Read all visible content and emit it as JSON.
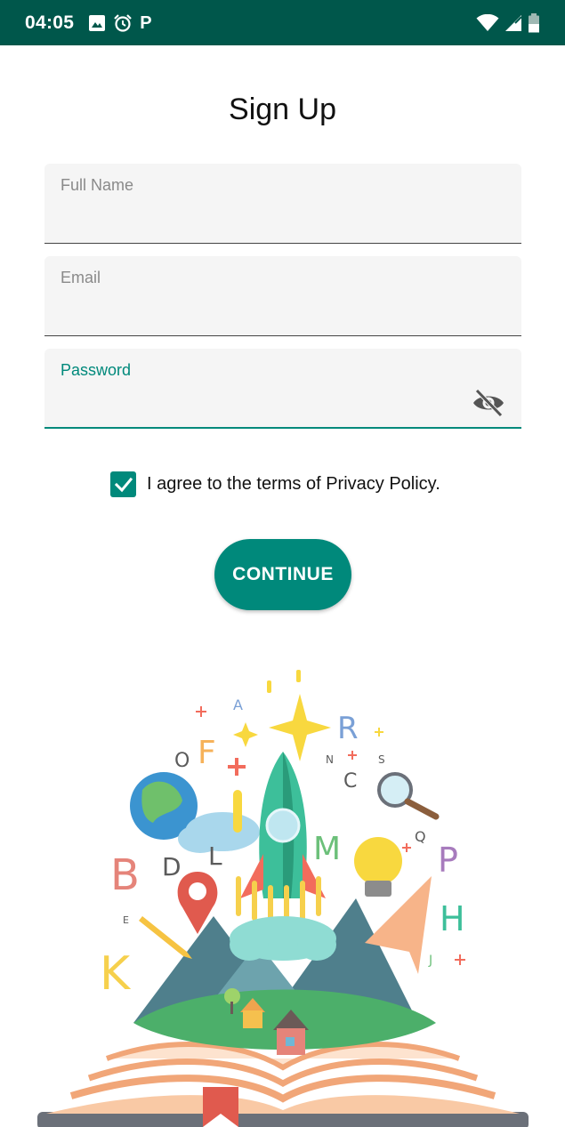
{
  "status_bar": {
    "time": "04:05",
    "p_badge": "P",
    "icons": [
      "image-icon",
      "alarm-icon",
      "parking-icon",
      "wifi-icon",
      "signal-icon",
      "battery-icon"
    ]
  },
  "page": {
    "title": "Sign Up"
  },
  "form": {
    "full_name": {
      "label": "Full Name",
      "value": ""
    },
    "email": {
      "label": "Email",
      "value": ""
    },
    "password": {
      "label": "Password",
      "value": ""
    }
  },
  "agree": {
    "checked": true,
    "text": "I agree to the terms of Privacy Policy."
  },
  "continue": {
    "label": "CONTINUE"
  },
  "illustration": {
    "letters": [
      "A",
      "O",
      "F",
      "R",
      "N",
      "S",
      "C",
      "Q",
      "P",
      "B",
      "D",
      "L",
      "M",
      "E",
      "H",
      "K",
      "J"
    ]
  },
  "colors": {
    "accent": "#00897b",
    "status_bar": "#00574b",
    "field_bg": "#f5f5f5"
  }
}
